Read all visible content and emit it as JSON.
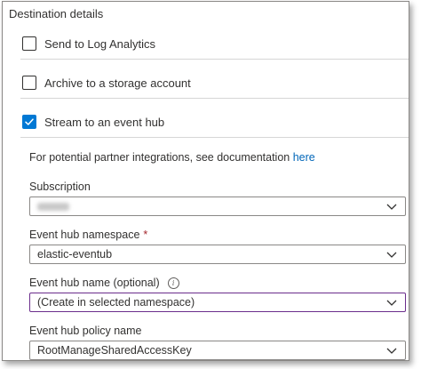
{
  "panel": {
    "title": "Destination details"
  },
  "checkboxes": [
    {
      "label": "Send to Log Analytics",
      "checked": false
    },
    {
      "label": "Archive to a storage account",
      "checked": false
    },
    {
      "label": "Stream to an event hub",
      "checked": true
    }
  ],
  "event_hub": {
    "info_text": "For potential partner integrations, see documentation",
    "info_link": "here",
    "subscription": {
      "label": "Subscription",
      "value": "cloud-dev",
      "value_obscured": true
    },
    "namespace": {
      "label": "Event hub namespace",
      "required_marker": "*",
      "value": "elastic-eventub"
    },
    "hub_name": {
      "label": "Event hub name (optional)",
      "value": "(Create in selected namespace)",
      "info_icon": "info-icon"
    },
    "policy": {
      "label": "Event hub policy name",
      "value": "RootManageSharedAccessKey"
    }
  },
  "colors": {
    "accent": "#0078d4",
    "focus_border": "#6b2d8c",
    "required": "#a4262c",
    "link": "#0066b8"
  }
}
